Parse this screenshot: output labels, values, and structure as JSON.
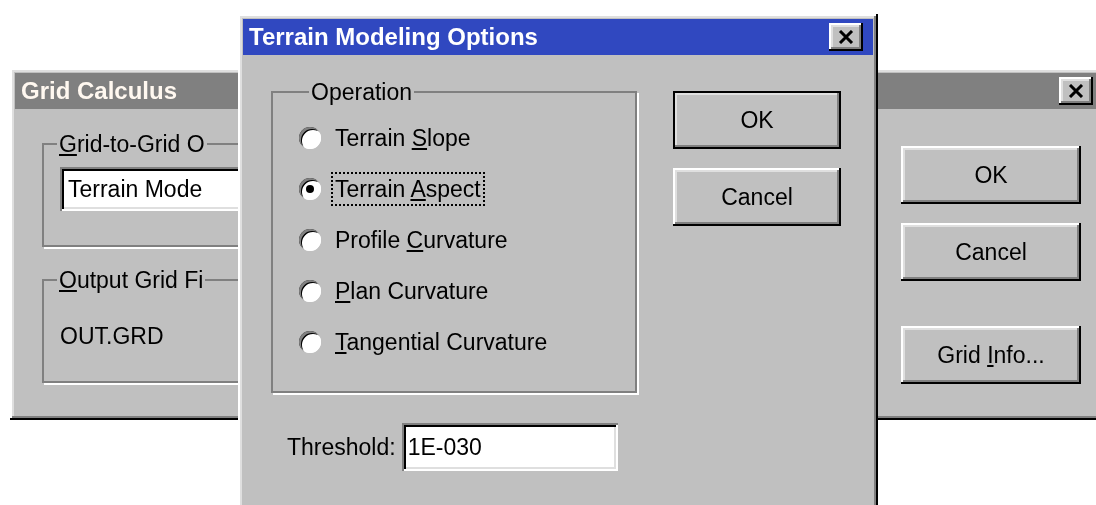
{
  "background_window": {
    "title": "Grid Calculus",
    "groups": [
      {
        "kind": "field",
        "legend": {
          "key": "G",
          "post": "rid-to-Grid O"
        },
        "value": "Terrain Mode"
      },
      {
        "kind": "text",
        "legend": {
          "key": "O",
          "post": "utput Grid Fi"
        },
        "value": "OUT.GRD"
      }
    ],
    "buttons": [
      {
        "label": {
          "pre": "OK"
        }
      },
      {
        "label": {
          "pre": "Cancel"
        }
      },
      {
        "label": {
          "pre": "Grid ",
          "key": "I",
          "post": "nfo..."
        }
      }
    ]
  },
  "dialog": {
    "title": "Terrain Modeling Options",
    "group_label": "Operation",
    "options": [
      {
        "label": {
          "pre": "Terrain ",
          "key": "S",
          "post": "lope"
        },
        "selected": false,
        "focused": false
      },
      {
        "label": {
          "pre": "Terrain ",
          "key": "A",
          "post": "spect"
        },
        "selected": true,
        "focused": true
      },
      {
        "label": {
          "pre": "Profile ",
          "key": "C",
          "post": "urvature"
        },
        "selected": false,
        "focused": false
      },
      {
        "label": {
          "key": "P",
          "post": "lan Curvature"
        },
        "selected": false,
        "focused": false
      },
      {
        "label": {
          "key": "T",
          "post": "angential Curvature"
        },
        "selected": false,
        "focused": false
      }
    ],
    "buttons": [
      {
        "label": "OK",
        "default": true
      },
      {
        "label": "Cancel",
        "default": false
      }
    ],
    "threshold": {
      "label": "Threshold:",
      "value": "1E-030"
    }
  }
}
